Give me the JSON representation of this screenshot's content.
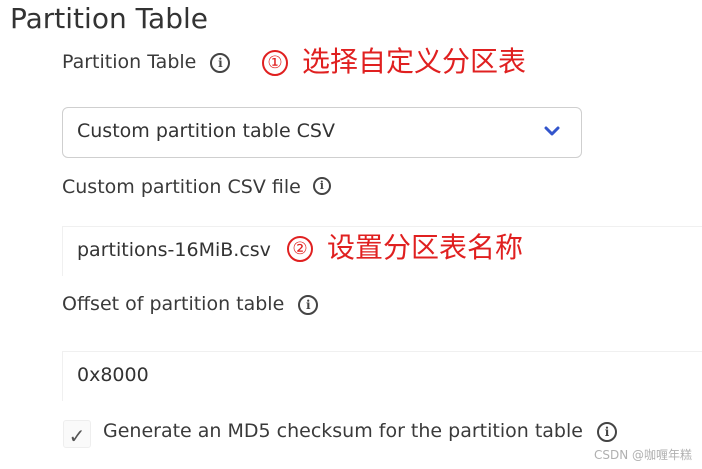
{
  "section": {
    "title": "Partition Table"
  },
  "partition_table": {
    "label": "Partition Table",
    "annotation_number": "①",
    "annotation_text": "选择自定义分区表",
    "selected_value": "Custom partition table CSV"
  },
  "csv_file": {
    "label": "Custom partition CSV file",
    "value": "partitions-16MiB.csv",
    "annotation_number": "②",
    "annotation_text": "设置分区表名称"
  },
  "offset": {
    "label": "Offset of partition table",
    "value": "0x8000"
  },
  "md5": {
    "checked_glyph": "✓",
    "label": "Generate an MD5 checksum for the partition table"
  },
  "icons": {
    "info": "info-icon",
    "dropdown": "chevron-down-icon",
    "check": "checkmark-icon"
  },
  "colors": {
    "annotation": "#e02020",
    "chevron": "#3355cc"
  },
  "watermark": "CSDN @咖喱年糕"
}
